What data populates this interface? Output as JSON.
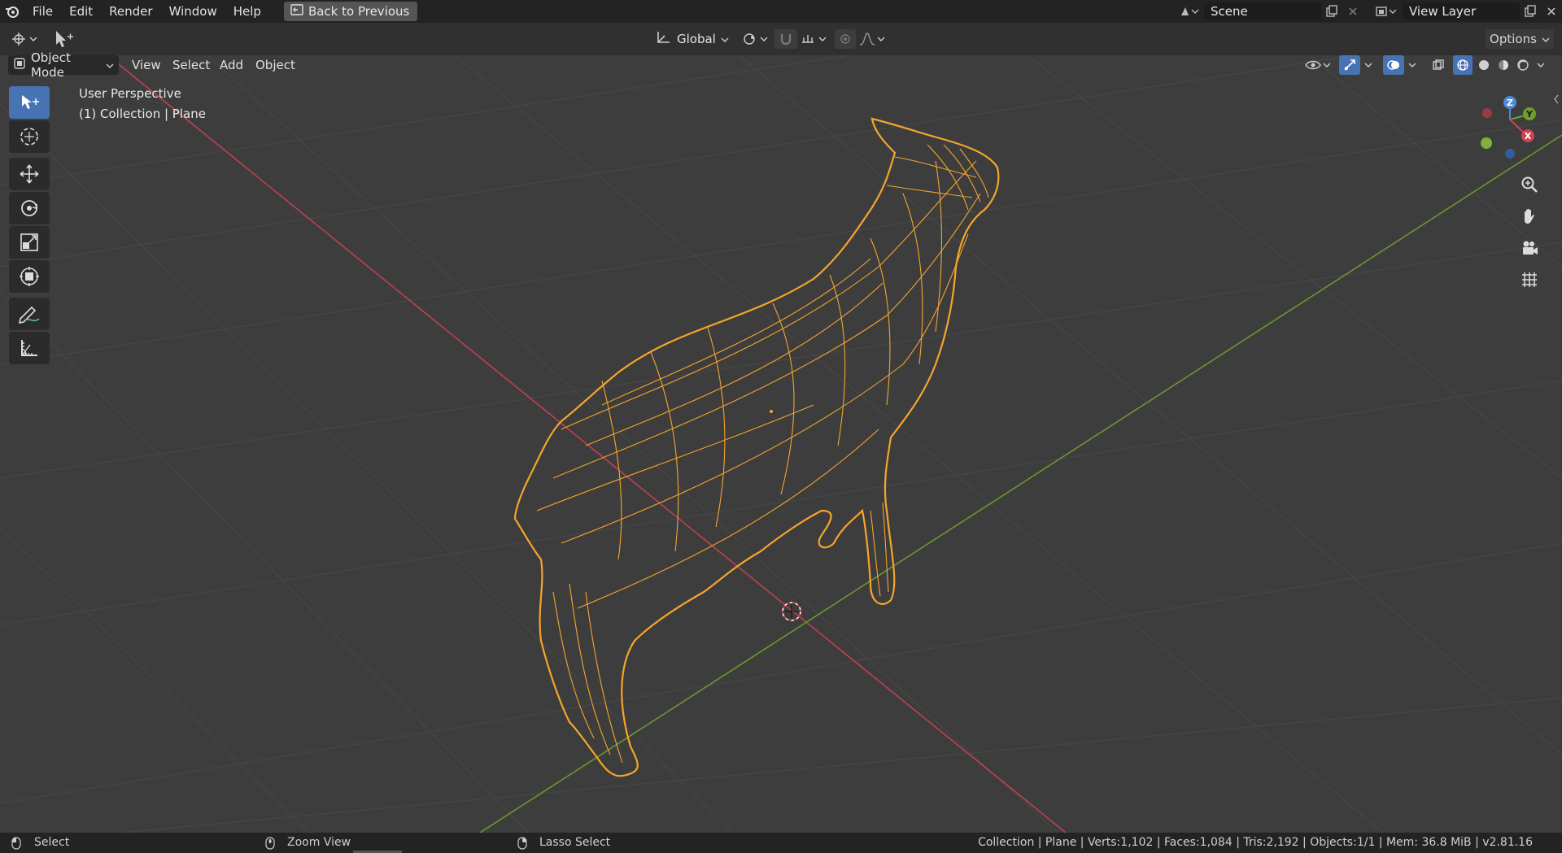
{
  "menu": {
    "items": [
      "File",
      "Edit",
      "Render",
      "Window",
      "Help"
    ],
    "back_label": "Back to Previous"
  },
  "scene": {
    "name": "Scene",
    "view_layer": "View Layer"
  },
  "toolbar": {
    "transform_orientation": "Global",
    "options_label": "Options"
  },
  "viewport_header": {
    "mode": "Object Mode",
    "menus": [
      "View",
      "Select",
      "Add",
      "Object"
    ]
  },
  "viewport": {
    "perspective": "User Perspective",
    "collection_info": "(1) Collection | Plane",
    "gizmo": {
      "z": "Z",
      "y": "Y",
      "x": "X"
    }
  },
  "left_tools": [
    "select-box",
    "cursor",
    "move",
    "rotate",
    "scale",
    "transform",
    "annotate",
    "measure"
  ],
  "status": {
    "select": "Select",
    "zoom": "Zoom View",
    "lasso": "Lasso Select",
    "stats": "Collection | Plane | Verts:1,102 | Faces:1,084 | Tris:2,192 | Objects:1/1 | Mem: 36.8 MiB | v2.81.16"
  },
  "colors": {
    "accent": "#4772b3",
    "selection": "#f5a52b",
    "x_axis": "#d0444f",
    "y_axis": "#6e9f2c",
    "z_axis": "#4f8ad9"
  }
}
